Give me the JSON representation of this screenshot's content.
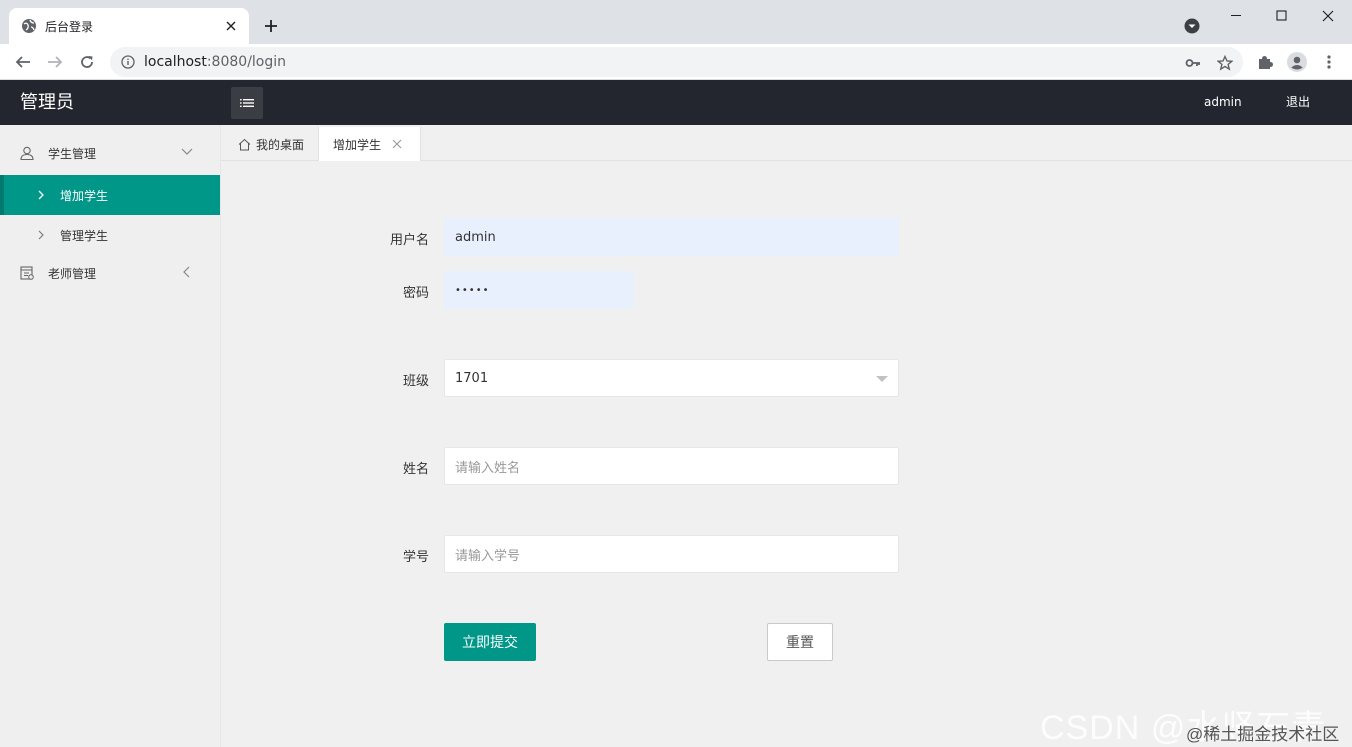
{
  "browser": {
    "tab_title": "后台登录",
    "url_host": "localhost",
    "url_rest": ":8080/login"
  },
  "header": {
    "logo": "管理员",
    "user": "admin",
    "logout": "退出"
  },
  "sidebar": {
    "groups": [
      {
        "label": "学生管理",
        "icon": "user-icon",
        "children": [
          {
            "label": "增加学生",
            "active": true
          },
          {
            "label": "管理学生",
            "active": false
          }
        ]
      },
      {
        "label": "老师管理",
        "icon": "template-icon"
      }
    ]
  },
  "page_tabs": {
    "home": "我的桌面",
    "current": "增加学生"
  },
  "form": {
    "username": {
      "label": "用户名",
      "value": "admin"
    },
    "password": {
      "label": "密码",
      "value": "•••••"
    },
    "class": {
      "label": "班级",
      "value": "1701"
    },
    "name": {
      "label": "姓名",
      "placeholder": "请输入姓名"
    },
    "student_no": {
      "label": "学号",
      "placeholder": "请输入学号"
    },
    "submit": "立即提交",
    "reset": "重置"
  },
  "watermark": {
    "csdn": "CSDN @水竖石青",
    "juejin": "@稀土掘金技术社区"
  },
  "colors": {
    "accent": "#009688",
    "header_bg": "#23262e"
  }
}
